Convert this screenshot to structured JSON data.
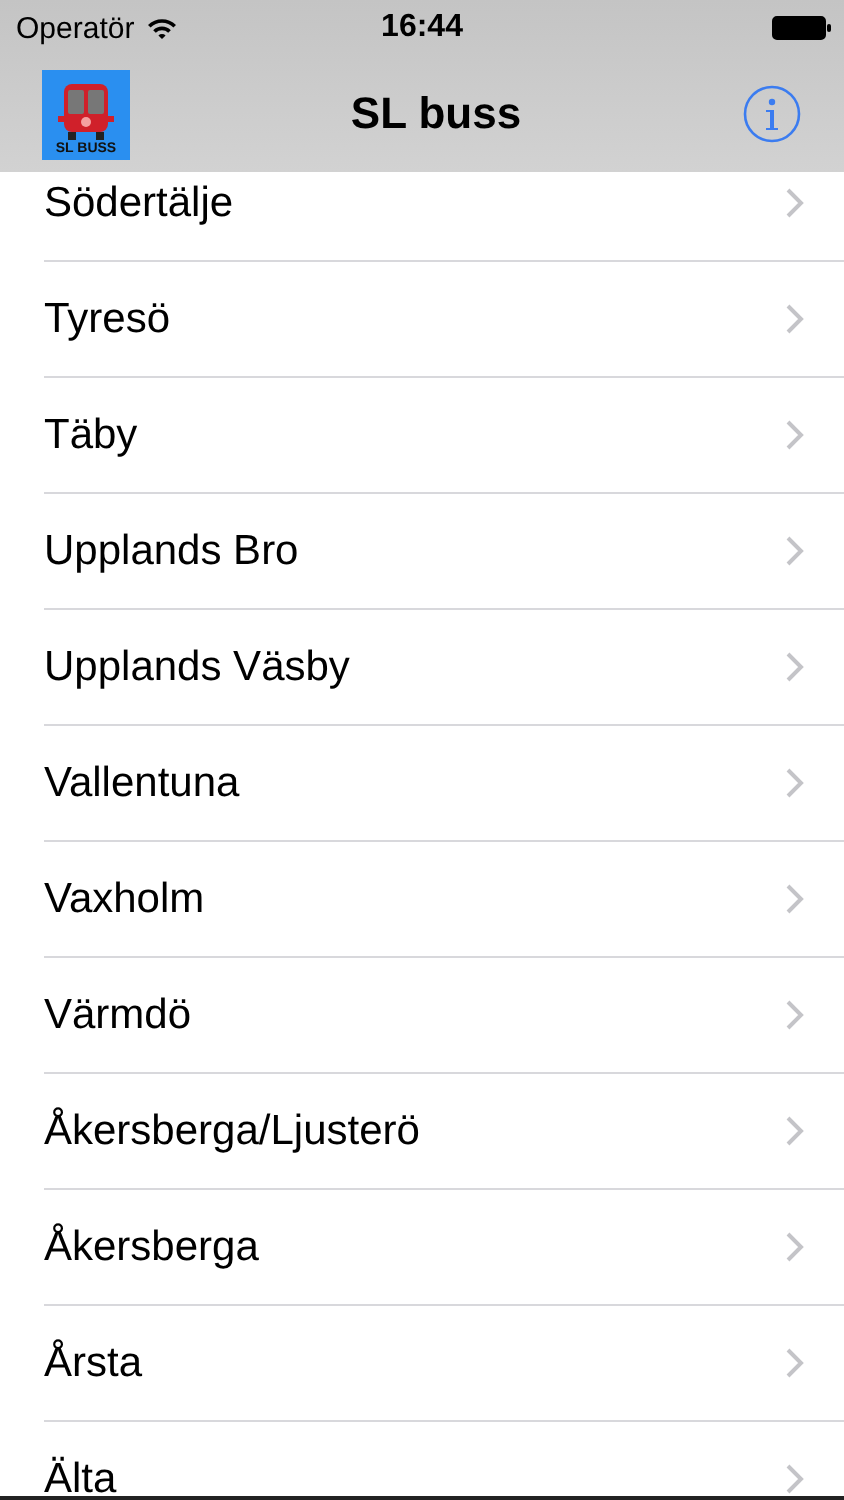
{
  "status_bar": {
    "carrier": "Operatör",
    "time": "16:44"
  },
  "nav_bar": {
    "logo_text": "SL BUSS",
    "title": "SL buss"
  },
  "list": {
    "items": [
      {
        "label": "Södertälje"
      },
      {
        "label": "Tyresö"
      },
      {
        "label": "Täby"
      },
      {
        "label": "Upplands Bro"
      },
      {
        "label": "Upplands Väsby"
      },
      {
        "label": "Vallentuna"
      },
      {
        "label": "Vaxholm"
      },
      {
        "label": "Värmdö"
      },
      {
        "label": "Åkersberga/Ljusterö"
      },
      {
        "label": "Åkersberga"
      },
      {
        "label": "Årsta"
      },
      {
        "label": "Älta"
      }
    ]
  }
}
